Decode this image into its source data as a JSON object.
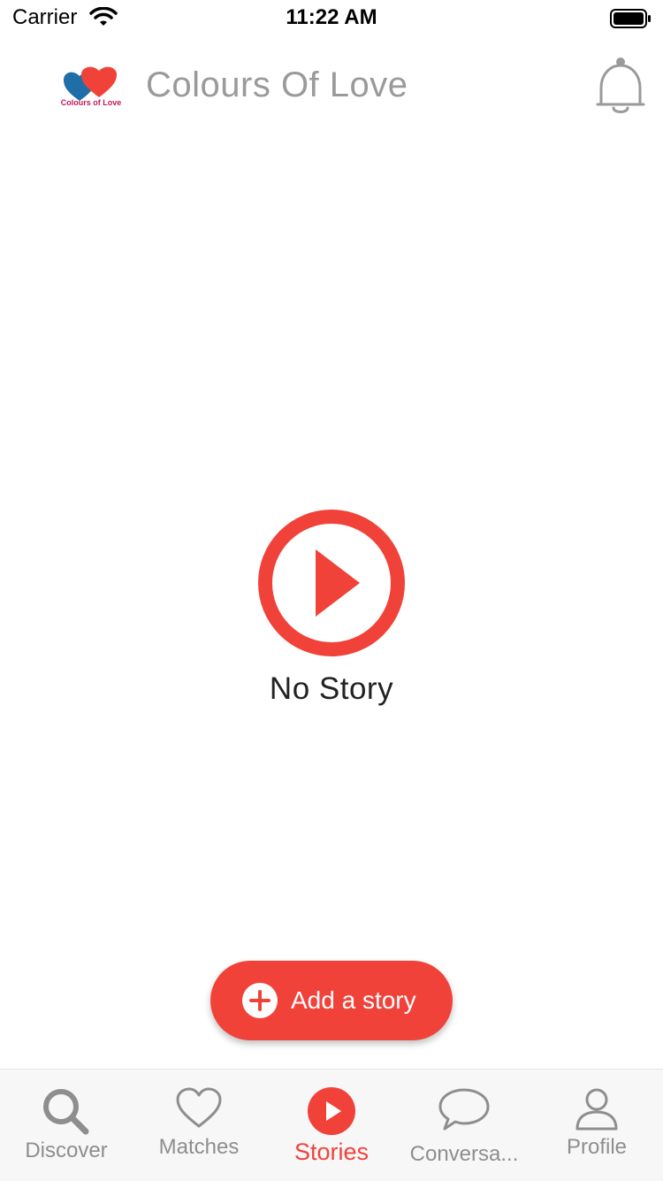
{
  "status_bar": {
    "carrier": "Carrier",
    "time": "11:22 AM"
  },
  "header": {
    "title": "Colours Of Love",
    "logo_text": "Colours of Love"
  },
  "empty_state": {
    "message": "No Story"
  },
  "add_story": {
    "label": "Add a story"
  },
  "tabs": [
    {
      "label": "Discover",
      "icon": "search-icon",
      "active": false
    },
    {
      "label": "Matches",
      "icon": "heart-icon",
      "active": false
    },
    {
      "label": "Stories",
      "icon": "play-icon",
      "active": true
    },
    {
      "label": "Conversa...",
      "icon": "chat-bubble-icon",
      "active": false
    },
    {
      "label": "Profile",
      "icon": "person-icon",
      "active": false
    }
  ],
  "colors": {
    "accent": "#f1423a",
    "inactive": "#8e8e8e",
    "title": "#9a9a9a"
  }
}
